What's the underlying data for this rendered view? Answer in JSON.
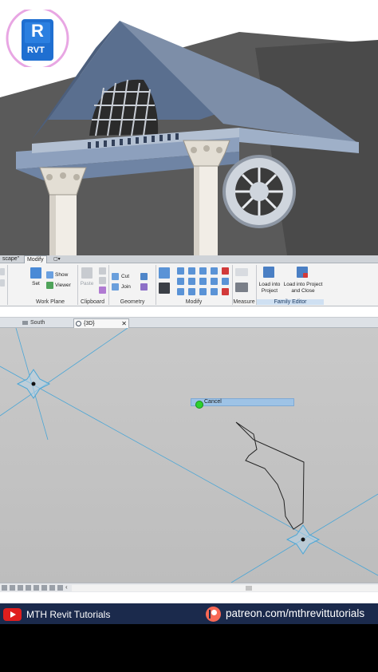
{
  "logo": {
    "letter": "R",
    "text": "RVT",
    "color": "#1f6fd1"
  },
  "ribbon": {
    "tabs": [
      "scape”",
      "Modify"
    ],
    "active_tab": "Modify",
    "panels": {
      "work_plane": {
        "label": "Work Plane",
        "set": "Set",
        "show": "Show",
        "viewer": "Viewer"
      },
      "clipboard": {
        "label": "Clipboard",
        "paste": "Paste"
      },
      "geometry": {
        "label": "Geometry",
        "cut": "Cut",
        "join": "Join"
      },
      "modify": {
        "label": "Modify"
      },
      "measure": {
        "label": "Measure"
      },
      "family_editor": {
        "label": "Family Editor",
        "load_into_project": "Load into Project",
        "load_into_project_close": "Load into Project and Close"
      }
    }
  },
  "view_tabs": [
    {
      "label": "South",
      "icon": "elevation-view-icon",
      "active": false
    },
    {
      "label": "{3D}",
      "icon": "3d-view-icon",
      "active": true
    }
  ],
  "close_glyph": "✕",
  "viewport": {
    "tooltip": "Cancel"
  },
  "banner": {
    "channel": "MTH Revit Tutorials",
    "patreon": "patreon.com/mthrevittutorials",
    "youtube_color": "#e01e1e",
    "patreon_color": "#f96854"
  }
}
